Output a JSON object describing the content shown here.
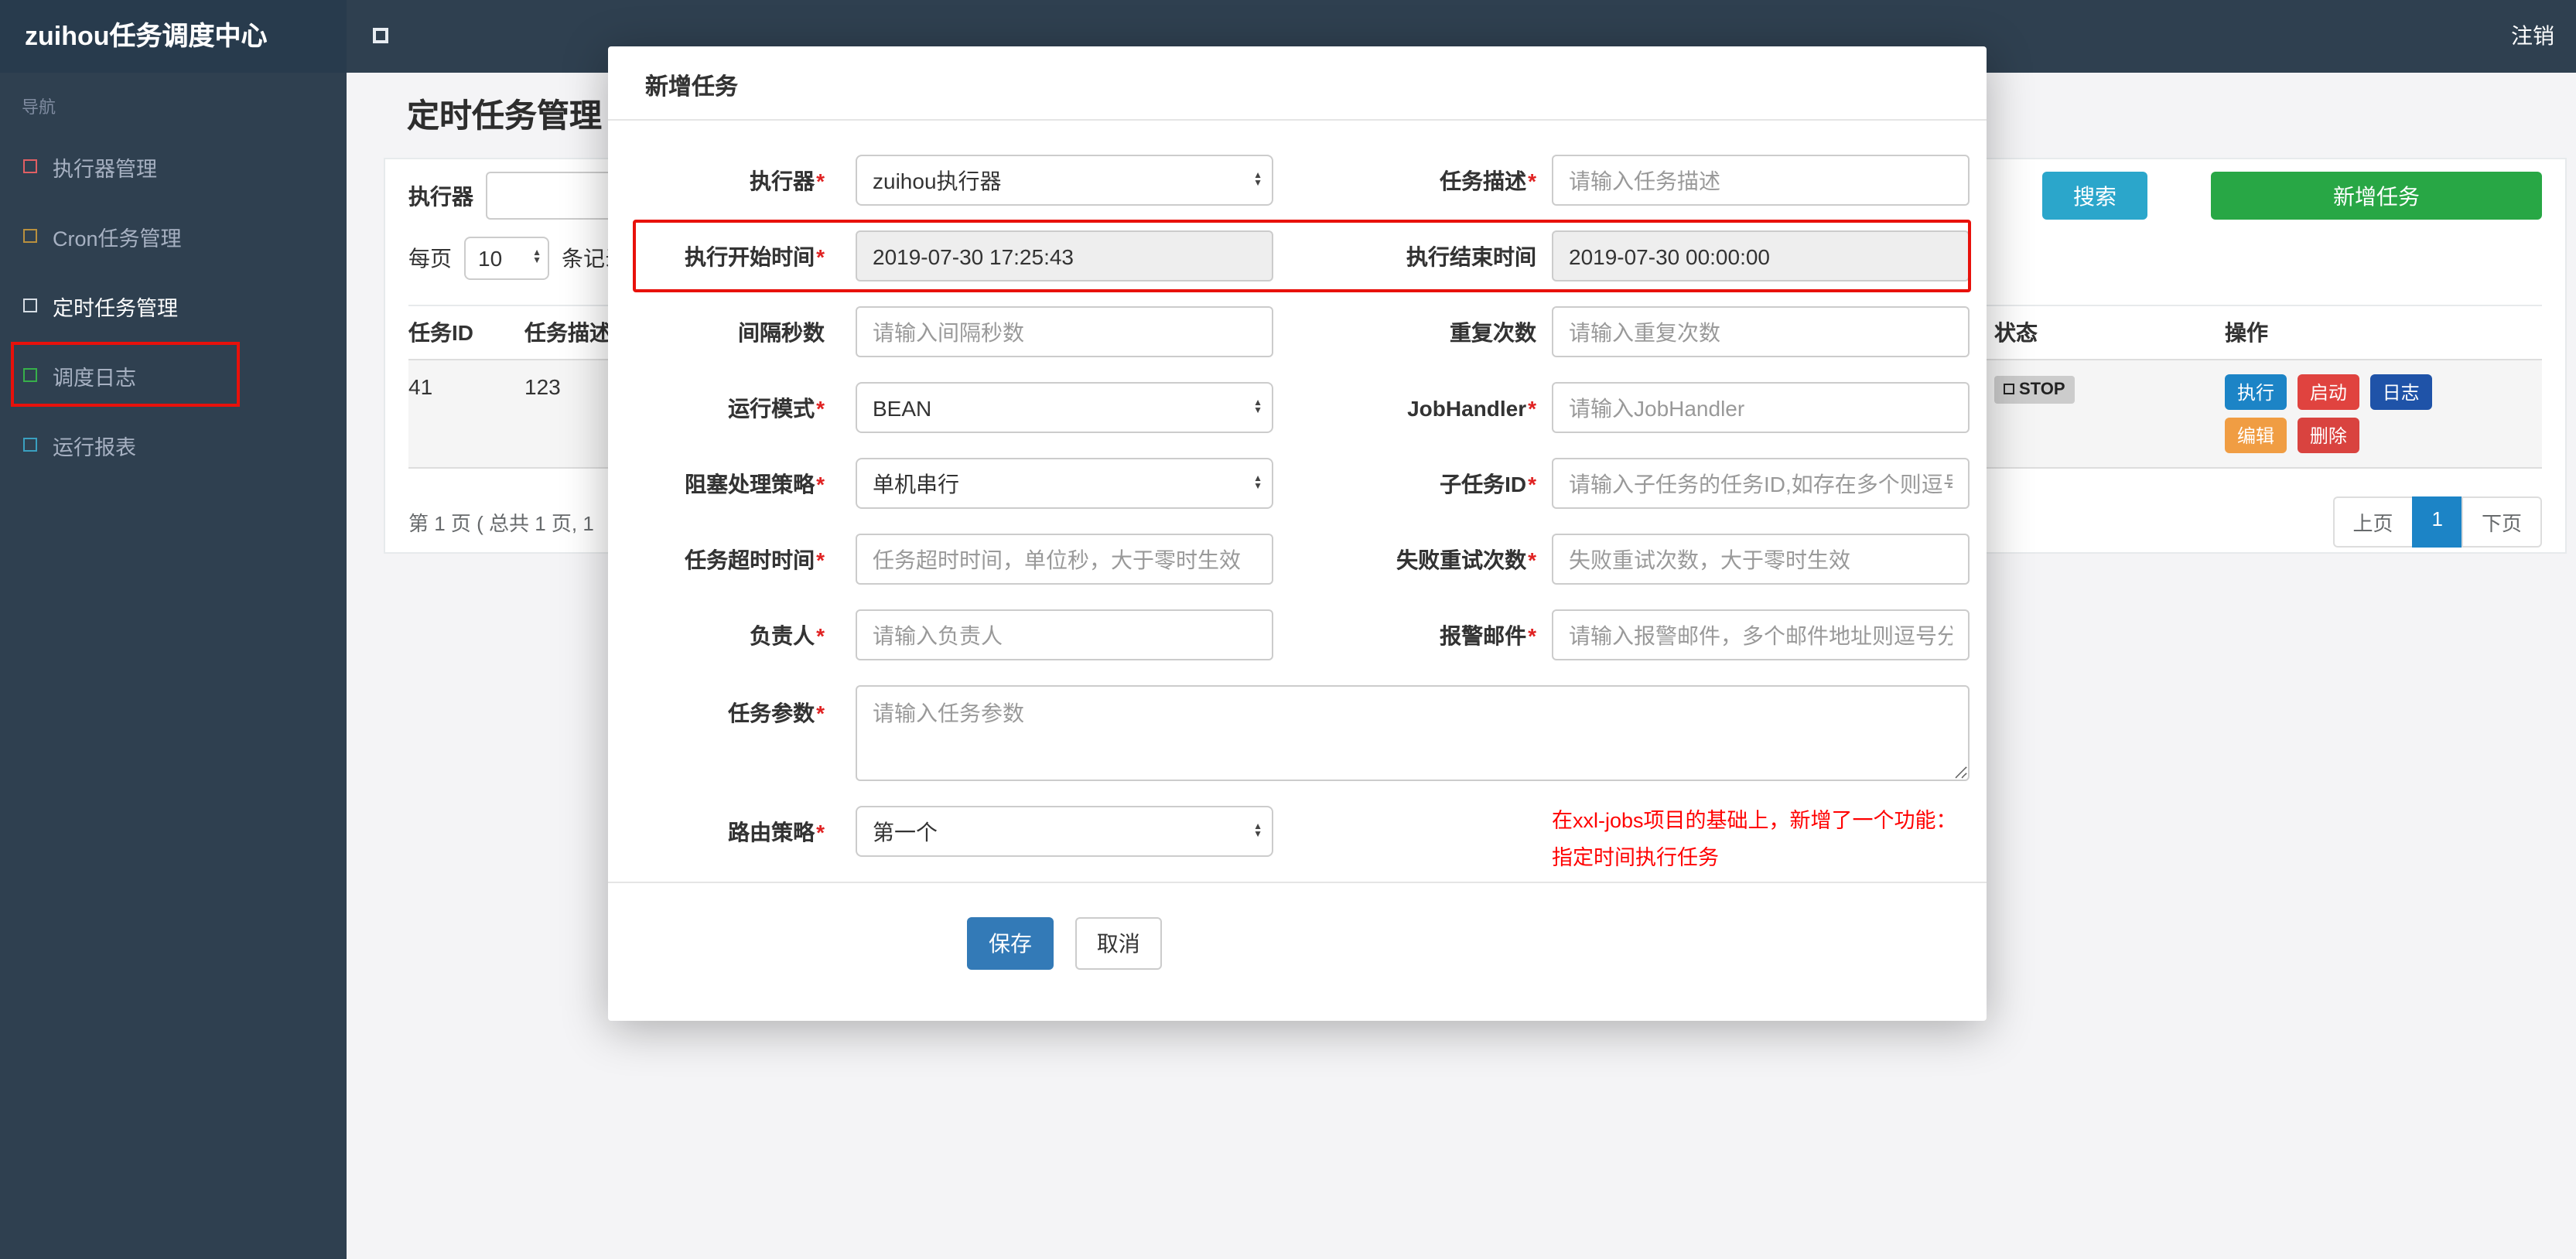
{
  "colors": {
    "accent_blue": "#1c84c6",
    "save_blue": "#337ab7",
    "search_teal": "#2ba6cb",
    "add_green": "#28a745",
    "annotation_red": "#e8110b",
    "note_red": "#ff0000"
  },
  "icons": {
    "select_up": "▲",
    "select_down": "▼"
  },
  "navbar": {
    "brand": "zuihou任务调度中心",
    "logout": "注销"
  },
  "sidebar": {
    "section_label": "导航",
    "items": [
      {
        "label": "执行器管理",
        "icon_color": "#e15f63"
      },
      {
        "label": "Cron任务管理",
        "icon_color": "#b9903e"
      },
      {
        "label": "定时任务管理",
        "icon_color": "#d7dde4"
      },
      {
        "label": "调度日志",
        "icon_color": "#37b04a"
      },
      {
        "label": "运行报表",
        "icon_color": "#3aa0c0"
      }
    ]
  },
  "page": {
    "title": "定时任务管理",
    "toolbar": {
      "executor_label": "执行器",
      "search": "搜索",
      "add_task": "新增任务"
    },
    "per_page": {
      "prefix": "每页",
      "value": "10",
      "suffix": "条记录"
    },
    "table": {
      "headers": {
        "id": "任务ID",
        "desc": "任务描述",
        "status": "状态",
        "ops": "操作"
      },
      "row": {
        "id": "41",
        "desc": "123",
        "status": "STOP",
        "actions": [
          {
            "label": "执行",
            "color": "#1c84c6"
          },
          {
            "label": "启动",
            "color": "#e0433f"
          },
          {
            "label": "日志",
            "color": "#1f53a8"
          },
          {
            "label": "编辑",
            "color": "#f09d43"
          },
          {
            "label": "删除",
            "color": "#d9433f"
          }
        ]
      }
    },
    "summary": "第 1 页 ( 总共 1 页, 1",
    "pagination": {
      "prev": "上页",
      "page": "1",
      "next": "下页"
    }
  },
  "modal": {
    "title": "新增任务",
    "required_mark": "*",
    "rows": [
      {
        "left": {
          "label": "执行器",
          "value": "zuihou执行器"
        },
        "right": {
          "label": "任务描述",
          "placeholder": "请输入任务描述"
        }
      },
      {
        "left": {
          "label": "执行开始时间",
          "value": "2019-07-30 17:25:43"
        },
        "right": {
          "label": "执行结束时间",
          "value": "2019-07-30 00:00:00"
        }
      },
      {
        "left": {
          "label": "间隔秒数",
          "placeholder": "请输入间隔秒数"
        },
        "right": {
          "label": "重复次数",
          "placeholder": "请输入重复次数"
        }
      },
      {
        "left": {
          "label": "运行模式",
          "value": "BEAN"
        },
        "right": {
          "label": "JobHandler",
          "placeholder": "请输入JobHandler"
        }
      },
      {
        "left": {
          "label": "阻塞处理策略",
          "value": "单机串行"
        },
        "right": {
          "label": "子任务ID",
          "placeholder": "请输入子任务的任务ID,如存在多个则逗号分隔"
        }
      },
      {
        "left": {
          "label": "任务超时时间",
          "placeholder": "任务超时时间，单位秒，大于零时生效"
        },
        "right": {
          "label": "失败重试次数",
          "placeholder": "失败重试次数，大于零时生效"
        }
      },
      {
        "left": {
          "label": "负责人",
          "placeholder": "请输入负责人"
        },
        "right": {
          "label": "报警邮件",
          "placeholder": "请输入报警邮件，多个邮件地址则逗号分隔"
        }
      }
    ],
    "params": {
      "label": "任务参数",
      "placeholder": "请输入任务参数"
    },
    "route": {
      "label": "路由策略",
      "value": "第一个"
    },
    "note_line1": "在xxl-jobs项目的基础上，新增了一个功能：",
    "note_line2": "指定时间执行任务",
    "save": "保存",
    "cancel": "取消"
  }
}
